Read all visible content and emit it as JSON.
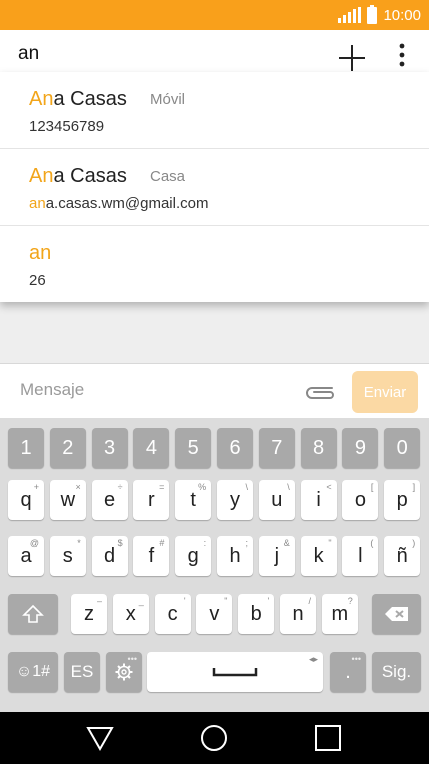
{
  "status_bar": {
    "time": "10:00",
    "bg_color": "#f9a01b"
  },
  "toolbar": {
    "recipient_value": "an",
    "icons": [
      "plus-icon",
      "more-vert-icon"
    ]
  },
  "suggestions": [
    {
      "name_match": "An",
      "name_rest": "a Casas",
      "type": "Móvil",
      "detail_match": "",
      "detail_rest": "123456789"
    },
    {
      "name_match": "An",
      "name_rest": "a Casas",
      "type": "Casa",
      "detail_match": "an",
      "detail_rest": "a.casas.wm@gmail.com"
    },
    {
      "name_match": "an",
      "name_rest": "",
      "type": "",
      "detail_match": "",
      "detail_rest": "26"
    }
  ],
  "compose": {
    "placeholder": "Mensaje",
    "send_label": "Enviar"
  },
  "keyboard": {
    "row1": [
      "1",
      "2",
      "3",
      "4",
      "5",
      "6",
      "7",
      "8",
      "9",
      "0"
    ],
    "row2": [
      [
        "q",
        "+"
      ],
      [
        "w",
        "×"
      ],
      [
        "e",
        "÷"
      ],
      [
        "r",
        "="
      ],
      [
        "t",
        "%"
      ],
      [
        "y",
        "\\"
      ],
      [
        "u",
        "\\"
      ],
      [
        "i",
        "<"
      ],
      [
        "o",
        "["
      ],
      [
        "p",
        "]"
      ]
    ],
    "row3": [
      [
        "a",
        "@"
      ],
      [
        "s",
        "*"
      ],
      [
        "d",
        "$"
      ],
      [
        "f",
        "#"
      ],
      [
        "g",
        ":"
      ],
      [
        "h",
        ";"
      ],
      [
        "j",
        "&"
      ],
      [
        "k",
        "\""
      ],
      [
        "l",
        "("
      ],
      [
        "ñ",
        ")"
      ]
    ],
    "row4": [
      [
        "z",
        "–"
      ],
      [
        "x",
        "_"
      ],
      [
        "c",
        "'"
      ],
      [
        "v",
        "\""
      ],
      [
        "b",
        "'"
      ],
      [
        "n",
        "/"
      ],
      [
        "m",
        "?"
      ]
    ],
    "symbols_label": "☺1#",
    "lang_label": "ES",
    "period_label": ".",
    "next_label": "Sig."
  },
  "accent_color": "#f2a51a"
}
